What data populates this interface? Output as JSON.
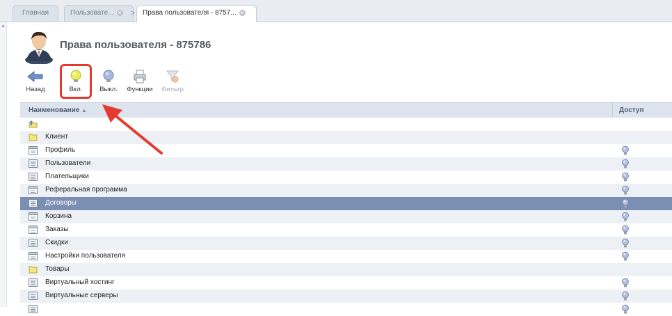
{
  "tabs": [
    {
      "label": "Главная"
    },
    {
      "label": "Пользовате..."
    },
    {
      "label": "Права пользователя - 8757..."
    }
  ],
  "page": {
    "title": "Права пользователя - 875786",
    "icon": "user-avatar-icon"
  },
  "toolbar": {
    "back_label": "Назад",
    "on_label": "Вкл.",
    "off_label": "Выкл.",
    "functions_label": "Функции",
    "filter_label": "Фильтр"
  },
  "grid": {
    "col_name": "Наименование",
    "col_access": "Доступ",
    "rows": [
      {
        "label": "",
        "kind": "up-folder",
        "access": false
      },
      {
        "label": "Клиент",
        "kind": "folder",
        "access": false
      },
      {
        "label": "Профиль",
        "kind": "form",
        "access": true
      },
      {
        "label": "Пользователи",
        "kind": "list",
        "access": true
      },
      {
        "label": "Плательщики",
        "kind": "list",
        "access": true
      },
      {
        "label": "Реферальная программа",
        "kind": "form",
        "access": true
      },
      {
        "label": "Договоры",
        "kind": "list",
        "access": true,
        "selected": true
      },
      {
        "label": "Корзина",
        "kind": "form",
        "access": true
      },
      {
        "label": "Заказы",
        "kind": "form",
        "access": true
      },
      {
        "label": "Скидки",
        "kind": "list",
        "access": true
      },
      {
        "label": "Настройки пользователя",
        "kind": "form",
        "access": true
      },
      {
        "label": "Товары",
        "kind": "folder",
        "access": false
      },
      {
        "label": "Виртуальный хостинг",
        "kind": "list",
        "access": true
      },
      {
        "label": "Виртуальные серверы",
        "kind": "list",
        "access": true
      },
      {
        "label": "",
        "kind": "list",
        "access": true
      }
    ]
  },
  "colors": {
    "highlight": "#e53a2f",
    "selected_row": "#7b8fb5",
    "header_bg": "#dde4ed"
  }
}
